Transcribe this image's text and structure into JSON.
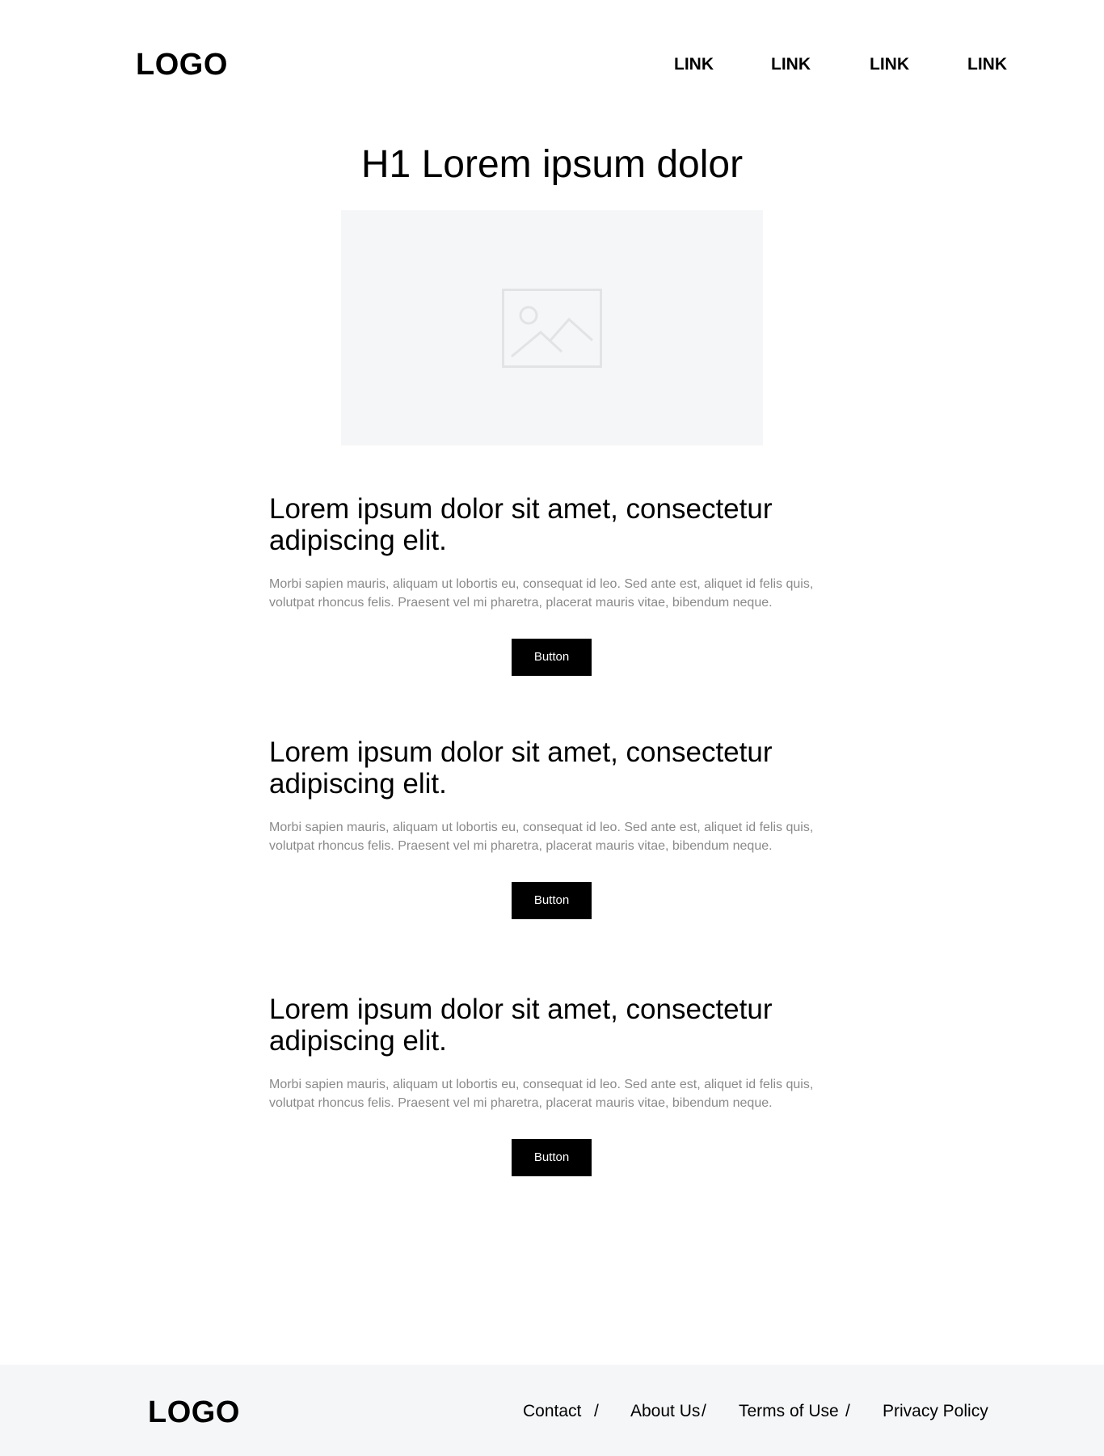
{
  "header": {
    "logo": "LOGO",
    "nav_links": [
      "LINK",
      "LINK",
      "LINK",
      "LINK"
    ]
  },
  "hero": {
    "title": "H1 Lorem ipsum dolor",
    "image_icon": "image-placeholder-icon"
  },
  "sections": [
    {
      "heading": "Lorem ipsum dolor sit amet, consectetur adipiscing elit.",
      "body": "Morbi sapien mauris, aliquam ut lobortis eu, consequat id leo. Sed ante est, aliquet id felis quis, volutpat rhoncus felis. Praesent vel mi pharetra, placerat mauris vitae, bibendum neque.",
      "button_label": "Button"
    },
    {
      "heading": "Lorem ipsum dolor sit amet, consectetur adipiscing elit.",
      "body": "Morbi sapien mauris, aliquam ut lobortis eu, consequat id leo. Sed ante est, aliquet id felis quis, volutpat rhoncus felis. Praesent vel mi pharetra, placerat mauris vitae, bibendum neque.",
      "button_label": "Button"
    },
    {
      "heading": "Lorem ipsum dolor sit amet, consectetur adipiscing elit.",
      "body": "Morbi sapien mauris, aliquam ut lobortis eu, consequat id leo. Sed ante est, aliquet id felis quis, volutpat rhoncus felis. Praesent vel mi pharetra, placerat mauris vitae, bibendum neque.",
      "button_label": "Button"
    }
  ],
  "footer": {
    "logo": "LOGO",
    "links": [
      "Contact",
      "About Us",
      "Terms of Use",
      "Privacy Policy"
    ],
    "separator": "/"
  },
  "colors": {
    "background": "#ffffff",
    "placeholder_bg": "#f5f6f8",
    "body_text": "#8a8a8a",
    "button_bg": "#000000",
    "button_text": "#ffffff"
  }
}
